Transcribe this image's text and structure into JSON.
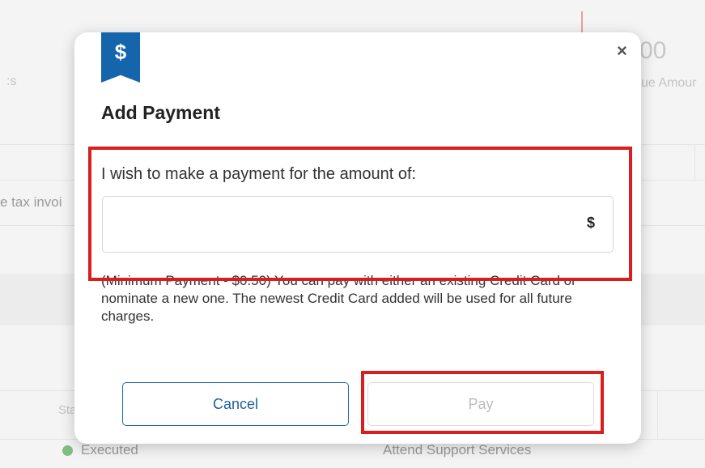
{
  "background": {
    "frag_left_top": ":s",
    "frag_amount": "00",
    "frag_due_label": "ue Amour",
    "frag_tax": "e tax invoi",
    "frag_status": "Sta",
    "frag_executed": "Executed",
    "frag_service": "Attend Support Services"
  },
  "modal": {
    "ribbon_symbol": "$",
    "close_symbol": "×",
    "title": "Add Payment",
    "prompt": "I wish to make a payment for the amount of:",
    "amount_value": "",
    "currency_symbol": "$",
    "info_struck": "(Minimum Payment - $0.50) You can pay with either an existing Credit",
    "info_rest": "Card or nominate a new one. The newest Credit Card added will be used for all future charges.",
    "cancel_label": "Cancel",
    "pay_label": "Pay"
  },
  "colors": {
    "brand_blue": "#1565ad",
    "highlight_red": "#d81e1e",
    "status_green": "#7fbf7f"
  }
}
